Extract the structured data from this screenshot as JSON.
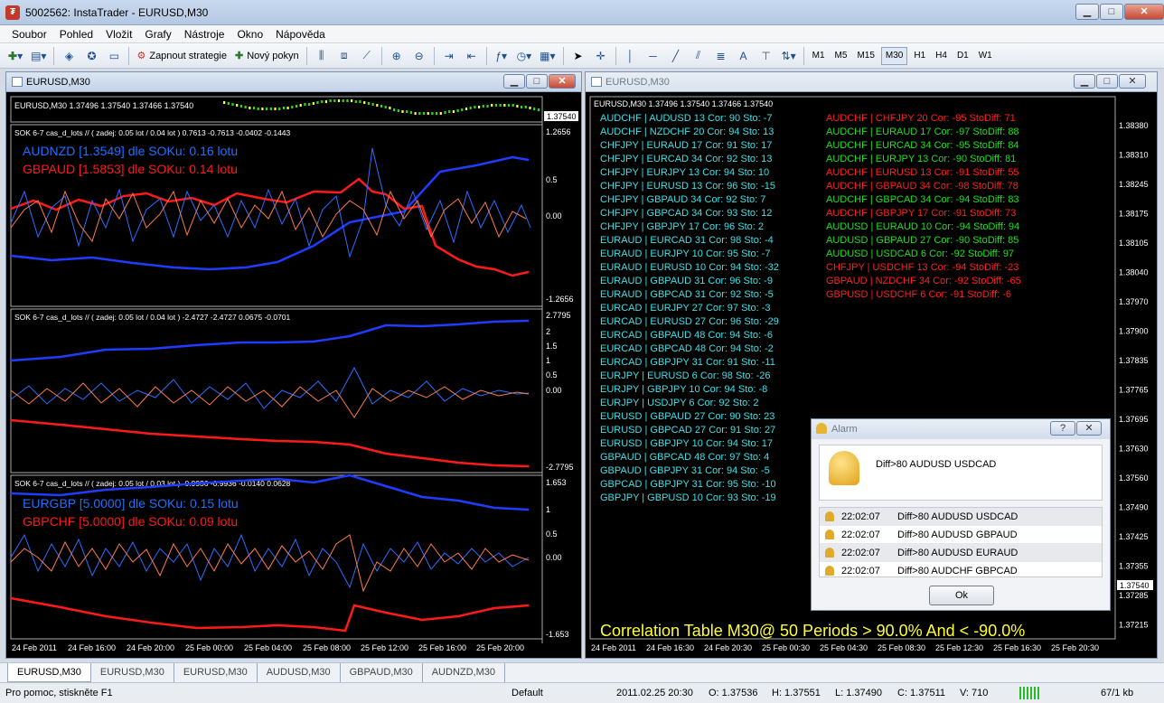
{
  "window": {
    "title": "5002562: InstaTrader - EURUSD,M30",
    "minimize": "▁",
    "maximize": "□",
    "close": "✕"
  },
  "menu": [
    "Soubor",
    "Pohled",
    "Vložit",
    "Grafy",
    "Nástroje",
    "Okno",
    "Nápověda"
  ],
  "toolbar": {
    "strategy_label": "Zapnout strategie",
    "order_label": "Nový pokyn",
    "timeframes": [
      "M1",
      "M5",
      "M15",
      "M30",
      "H1",
      "H4",
      "D1",
      "W1"
    ],
    "active_timeframe": "M30",
    "text_tool": "A"
  },
  "left_chart": {
    "title": "EURUSD,M30",
    "header": "EURUSD,M30  1.37496 1.37540 1.37466 1.37540",
    "price_label": "1.37540",
    "panel1": {
      "header": "SOK 6-7 cas_d_lots // ( zadej: 0.05 lot / 0.04 lot )  0.7613 -0.7613 -0.0402 -0.1443",
      "line1": "AUDNZD [1.3549]  dle SOKu: 0.16 lotu",
      "line2": "GBPAUD [1.5853]  dle SOKu: 0.14 lotu",
      "scale": [
        "1.2656",
        "0.5",
        "0.00",
        "-1.2656"
      ]
    },
    "panel2": {
      "header": "SOK 6-7 cas_d_lots // ( zadej: 0.05 lot / 0.04 lot ) -2.4727 -2.4727 0.0675 -0.0701",
      "scale": [
        "2.7795",
        "2",
        "1.5",
        "1",
        "0.5",
        "0.00",
        "-2.7795"
      ]
    },
    "panel3": {
      "header": "SOK 6-7 cas_d_lots // ( zadej: 0.05 lot / 0.03 lot ) -0.9936 -0.9936 -0.0140 0.0628",
      "line1": "EURGBP [5.0000]  dle SOKu: 0.15 lotu",
      "line2": "GBPCHF [5.0000]  dle SOKu: 0.09 lotu",
      "scale": [
        "1.653",
        "1",
        "0.5",
        "0.00",
        "-1.653"
      ]
    },
    "time_axis": [
      "24 Feb 2011",
      "24 Feb 16:00",
      "24 Feb 20:00",
      "25 Feb 00:00",
      "25 Feb 04:00",
      "25 Feb 08:00",
      "25 Feb 12:00",
      "25 Feb 16:00",
      "25 Feb 20:00"
    ]
  },
  "right_chart": {
    "title": "EURUSD,M30",
    "header": "EURUSD,M30  1.37496 1.37540 1.37466 1.37540",
    "price_scale": [
      "1.38380",
      "1.38310",
      "1.38245",
      "1.38175",
      "1.38105",
      "1.38040",
      "1.37970",
      "1.37900",
      "1.37835",
      "1.37765",
      "1.37695",
      "1.37630",
      "1.37560",
      "1.37490",
      "1.37425",
      "1.37355",
      "1.37285",
      "1.37215"
    ],
    "current_price": "1.37540",
    "cyan_rows": [
      "AUDCHF | AUDUSD  13  Cor: 90  Sto: -7",
      "AUDCHF | NZDCHF  20  Cor: 94  Sto: 13",
      "CHFJPY | EURAUD  17  Cor: 91  Sto: 17",
      "CHFJPY | EURCAD  34  Cor: 92  Sto: 13",
      "CHFJPY | EURJPY  13  Cor: 94  Sto: 10",
      "CHFJPY | EURUSD  13  Cor: 96  Sto: -15",
      "CHFJPY | GBPAUD  34  Cor: 92  Sto: 7",
      "CHFJPY | GBPCAD  34  Cor: 93  Sto: 12",
      "CHFJPY | GBPJPY  17  Cor: 96  Sto: 2",
      "EURAUD | EURCAD  31  Cor: 98  Sto: -4",
      "EURAUD | EURJPY  10  Cor: 95  Sto: -7",
      "EURAUD | EURUSD  10  Cor: 94  Sto: -32",
      "EURAUD | GBPAUD  31  Cor: 96  Sto: -9",
      "EURAUD | GBPCAD  31  Cor: 92  Sto: -5",
      "EURCAD | EURJPY  27  Cor: 97  Sto: -3",
      "EURCAD | EURUSD  27  Cor: 96  Sto: -29",
      "EURCAD | GBPAUD  48  Cor: 94  Sto: -6",
      "EURCAD | GBPCAD  48  Cor: 94  Sto: -2",
      "EURCAD | GBPJPY  31  Cor: 91  Sto: -11",
      "EURJPY | EURUSD  6  Cor: 98  Sto: -26",
      "EURJPY | GBPJPY  10  Cor: 94  Sto: -8",
      "EURJPY | USDJPY  6  Cor: 92  Sto: 2",
      "EURUSD | GBPAUD  27  Cor: 90  Sto: 23",
      "EURUSD | GBPCAD  27  Cor: 91  Sto: 27",
      "EURUSD | GBPJPY  10  Cor: 94  Sto: 17",
      "GBPAUD | GBPCAD  48  Cor: 97  Sto: 4",
      "GBPAUD | GBPJPY  31  Cor: 94  Sto: -5",
      "GBPCAD | GBPJPY  31  Cor: 95  Sto: -10",
      "GBPJPY | GBPUSD  10  Cor: 93  Sto: -19"
    ],
    "diff_rows": [
      {
        "text": "AUDCHF | CHFJPY  20  Cor: -95  StoDiff: 71",
        "color": "#ff2020"
      },
      {
        "text": "AUDCHF | EURAUD  17  Cor: -97  StoDiff: 88",
        "color": "#22dd22"
      },
      {
        "text": "AUDCHF | EURCAD  34  Cor: -95  StoDiff: 84",
        "color": "#22dd22"
      },
      {
        "text": "AUDCHF | EURJPY  13  Cor: -90  StoDiff: 81",
        "color": "#22dd22"
      },
      {
        "text": "AUDCHF | EURUSD  13  Cor: -91  StoDiff: 55",
        "color": "#ff2020"
      },
      {
        "text": "AUDCHF | GBPAUD  34  Cor: -98  StoDiff: 78",
        "color": "#ff2020"
      },
      {
        "text": "AUDCHF | GBPCAD  34  Cor: -94  StoDiff: 83",
        "color": "#22dd22"
      },
      {
        "text": "AUDCHF | GBPJPY  17  Cor: -91  StoDiff: 73",
        "color": "#ff2020"
      },
      {
        "text": "AUDUSD | EURAUD  10  Cor: -94  StoDiff: 94",
        "color": "#22dd22"
      },
      {
        "text": "AUDUSD | GBPAUD  27  Cor: -90  StoDiff: 85",
        "color": "#22dd22"
      },
      {
        "text": "AUDUSD | USDCAD  6  Cor: -92  StoDiff: 97",
        "color": "#22dd22"
      },
      {
        "text": "CHFJPY | USDCHF  13  Cor: -94  StoDiff: -23",
        "color": "#ff2020"
      },
      {
        "text": "GBPAUD | NZDCHF  34  Cor: -92  StoDiff: -65",
        "color": "#ff2020"
      },
      {
        "text": "GBPUSD | USDCHF  6  Cor: -91  StoDiff: -6",
        "color": "#ff2020"
      }
    ],
    "footer_title": "Correlation Table M30@ 50 Periods > 90.0% And < -90.0%",
    "time_axis": [
      "24 Feb 2011",
      "24 Feb 16:30",
      "24 Feb 20:30",
      "25 Feb 00:30",
      "25 Feb 04:30",
      "25 Feb 08:30",
      "25 Feb 12:30",
      "25 Feb 16:30",
      "25 Feb 20:30"
    ]
  },
  "alarm": {
    "title": "Alarm",
    "help": "?",
    "close": "✕",
    "message": "Diff>80 AUDUSD USDCAD",
    "rows": [
      {
        "time": "22:02:07",
        "msg": "Diff>80 AUDUSD USDCAD"
      },
      {
        "time": "22:02:07",
        "msg": "Diff>80 AUDUSD GBPAUD"
      },
      {
        "time": "22:02:07",
        "msg": "Diff>80 AUDUSD EURAUD"
      },
      {
        "time": "22:02:07",
        "msg": "Diff>80 AUDCHF GBPCAD"
      }
    ],
    "ok": "Ok"
  },
  "tabs": [
    "EURUSD,M30",
    "EURUSD,M30",
    "EURUSD,M30",
    "AUDUSD,M30",
    "GBPAUD,M30",
    "AUDNZD,M30"
  ],
  "status": {
    "help": "Pro pomoc, stiskněte F1",
    "profile": "Default",
    "datetime": "2011.02.25 20:30",
    "open": "O: 1.37536",
    "high": "H: 1.37551",
    "low": "L: 1.37490",
    "close": "C: 1.37511",
    "volume": "V: 710",
    "traffic": "67/1 kb"
  },
  "colors": {
    "blue": "#1f3cff",
    "red": "#ff1a1a",
    "cyan": "#3ee0e6",
    "yellow": "#ffff33"
  }
}
